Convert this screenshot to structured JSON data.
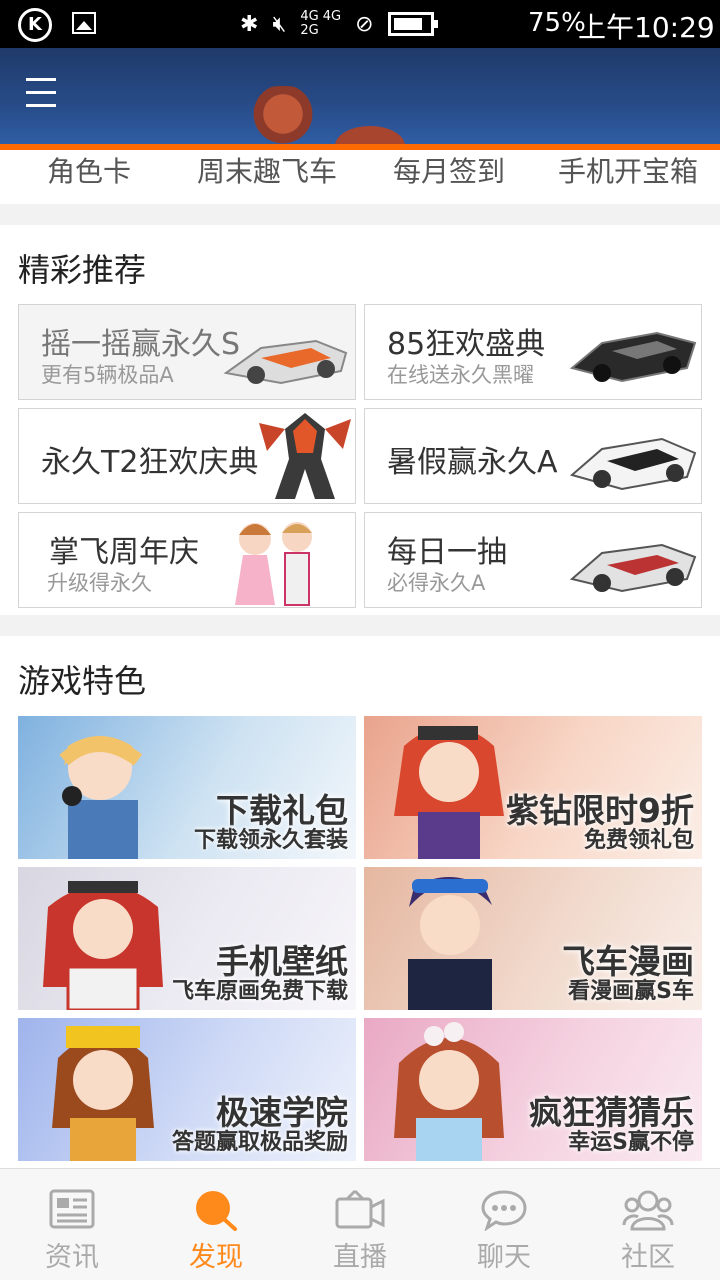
{
  "status_bar": {
    "network_top": "4G 4G",
    "network_bottom": "2G",
    "battery": "75%",
    "time": "上午10:29"
  },
  "quick_tabs": [
    "角色卡",
    "周末趣飞车",
    "每月签到",
    "手机开宝箱"
  ],
  "recommend": {
    "title": "精彩推荐",
    "cards": [
      {
        "title": "摇一摇赢永久S",
        "subtitle": "更有5辆极品A",
        "art": "race-car-orange"
      },
      {
        "title": "85狂欢盛典",
        "subtitle": "在线送永久黑曜",
        "art": "race-car-black"
      },
      {
        "title": "永久T2狂欢庆典",
        "subtitle": "",
        "art": "mecha-robot"
      },
      {
        "title": "暑假赢永久A",
        "subtitle": "",
        "art": "race-car-white"
      },
      {
        "title": "掌飞周年庆",
        "subtitle": "升级得永久",
        "art": "chibi-couple"
      },
      {
        "title": "每日一抽",
        "subtitle": "必得永久A",
        "art": "race-car-silver"
      }
    ]
  },
  "features": {
    "title": "游戏特色",
    "cards": [
      {
        "title": "下载礼包",
        "subtitle": "下载领永久套装",
        "bg": "#a9cbe8",
        "char_color": "#f3c36a"
      },
      {
        "title": "紫钻限时9折",
        "subtitle": "免费领礼包",
        "bg": "#f6c0a6",
        "char_color": "#d9482e"
      },
      {
        "title": "手机壁纸",
        "subtitle": "飞车原画免费下载",
        "bg": "#e6e4ec",
        "char_color": "#c8352c"
      },
      {
        "title": "飞车漫画",
        "subtitle": "看漫画赢S车",
        "bg": "#f0d6c8",
        "char_color": "#3a2d6e"
      },
      {
        "title": "极速学院",
        "subtitle": "答题赢取极品奖励",
        "bg": "#c6d4f4",
        "char_color": "#9b4a1e"
      },
      {
        "title": "疯狂猜猜乐",
        "subtitle": "幸运S赢不停",
        "bg": "#f4c8da",
        "char_color": "#b8502f"
      }
    ]
  },
  "bottom_nav": [
    {
      "label": "资讯",
      "icon": "news-icon",
      "active": false
    },
    {
      "label": "发现",
      "icon": "discover-icon",
      "active": true
    },
    {
      "label": "直播",
      "icon": "live-video-icon",
      "active": false
    },
    {
      "label": "聊天",
      "icon": "chat-bubble-icon",
      "active": false
    },
    {
      "label": "社区",
      "icon": "community-icon",
      "active": false
    }
  ],
  "colors": {
    "accent": "#ff8a1c",
    "orange_line": "#ff6a00"
  }
}
